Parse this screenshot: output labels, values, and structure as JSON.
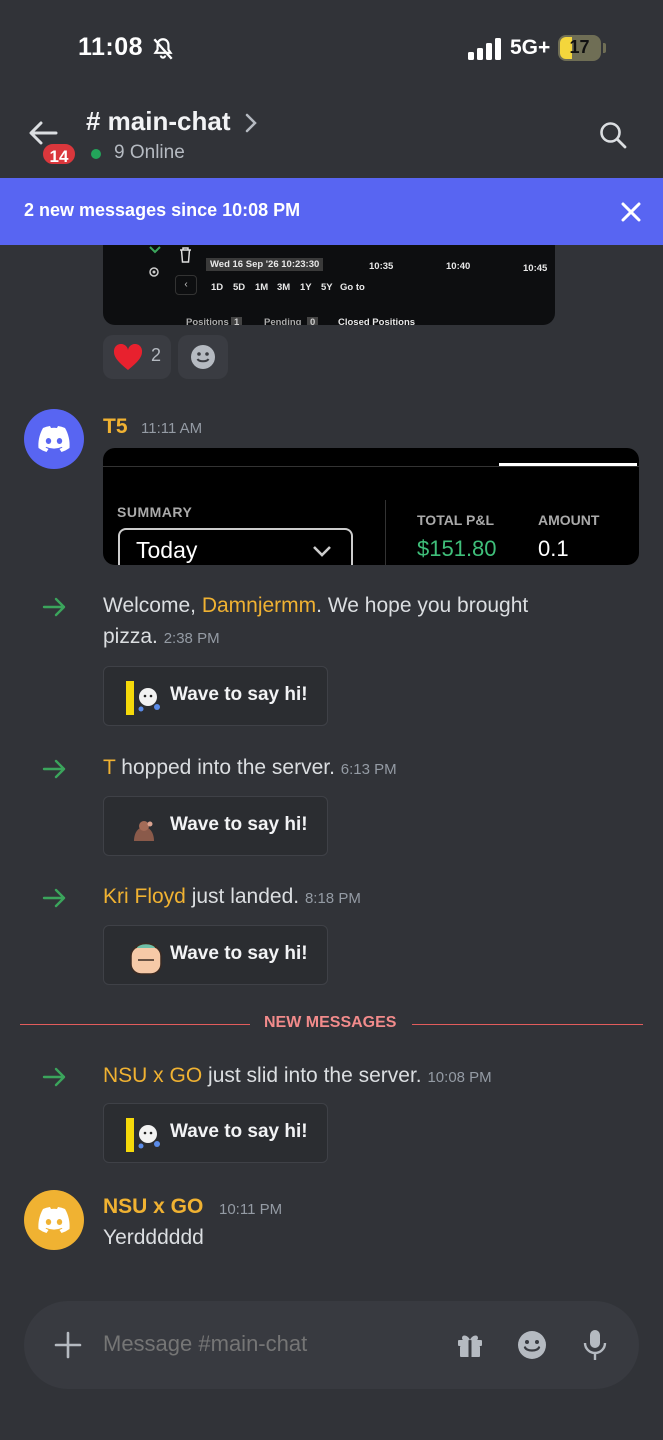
{
  "status_bar": {
    "time": "11:08",
    "network": "5G+",
    "battery": "17"
  },
  "header": {
    "channel": "# main-chat",
    "badge": "14",
    "online": "9 Online"
  },
  "banner": {
    "text": "2 new messages since 10:08 PM"
  },
  "chart_image": {
    "date": "Wed 16 Sep '26  10:23:30",
    "times": [
      "10:35",
      "10:40",
      "10:45"
    ],
    "ranges": [
      "1D",
      "5D",
      "1M",
      "3M",
      "1Y",
      "5Y",
      "Go to"
    ],
    "tabs": [
      "Positions",
      "Pending",
      "Closed Positions"
    ],
    "tab_counts": [
      "1",
      "0"
    ]
  },
  "reactions": {
    "heart_count": "2"
  },
  "messages": [
    {
      "author": "T5",
      "time": "11:11 AM",
      "summary_card": {
        "label": "SUMMARY",
        "dropdown": "Today",
        "pnl_label": "TOTAL P&L",
        "pnl_value": "$151.80",
        "amount_label": "AMOUNT",
        "amount_value": "0.1"
      }
    }
  ],
  "system_messages": [
    {
      "prefix": "Welcome, ",
      "name": "Damnjermm",
      "suffix": ". We hope you brought",
      "line2": "pizza.",
      "time": "2:38 PM",
      "wave": "Wave to say hi!"
    },
    {
      "prefix": "",
      "name": "T",
      "suffix": " hopped into the server.",
      "time": "6:13 PM",
      "wave": "Wave to say hi!"
    },
    {
      "prefix": "",
      "name": "Kri Floyd",
      "suffix": " just landed.",
      "time": "8:18 PM",
      "wave": "Wave to say hi!"
    },
    {
      "prefix": "",
      "name": "NSU x GO",
      "suffix": " just slid into the server.",
      "time": "10:08 PM",
      "wave": "Wave to say hi!"
    }
  ],
  "divider": {
    "label": "NEW MESSAGES"
  },
  "last_message": {
    "author": "NSU x GO",
    "time": "10:11 PM",
    "text": "Yerdddddd"
  },
  "composer": {
    "placeholder": "Message #main-chat"
  },
  "colors": {
    "accent": "#5865f2",
    "username": "#f0b232",
    "online": "#23a55a",
    "badge": "#da373c",
    "new_divider": "#e25c5c"
  }
}
